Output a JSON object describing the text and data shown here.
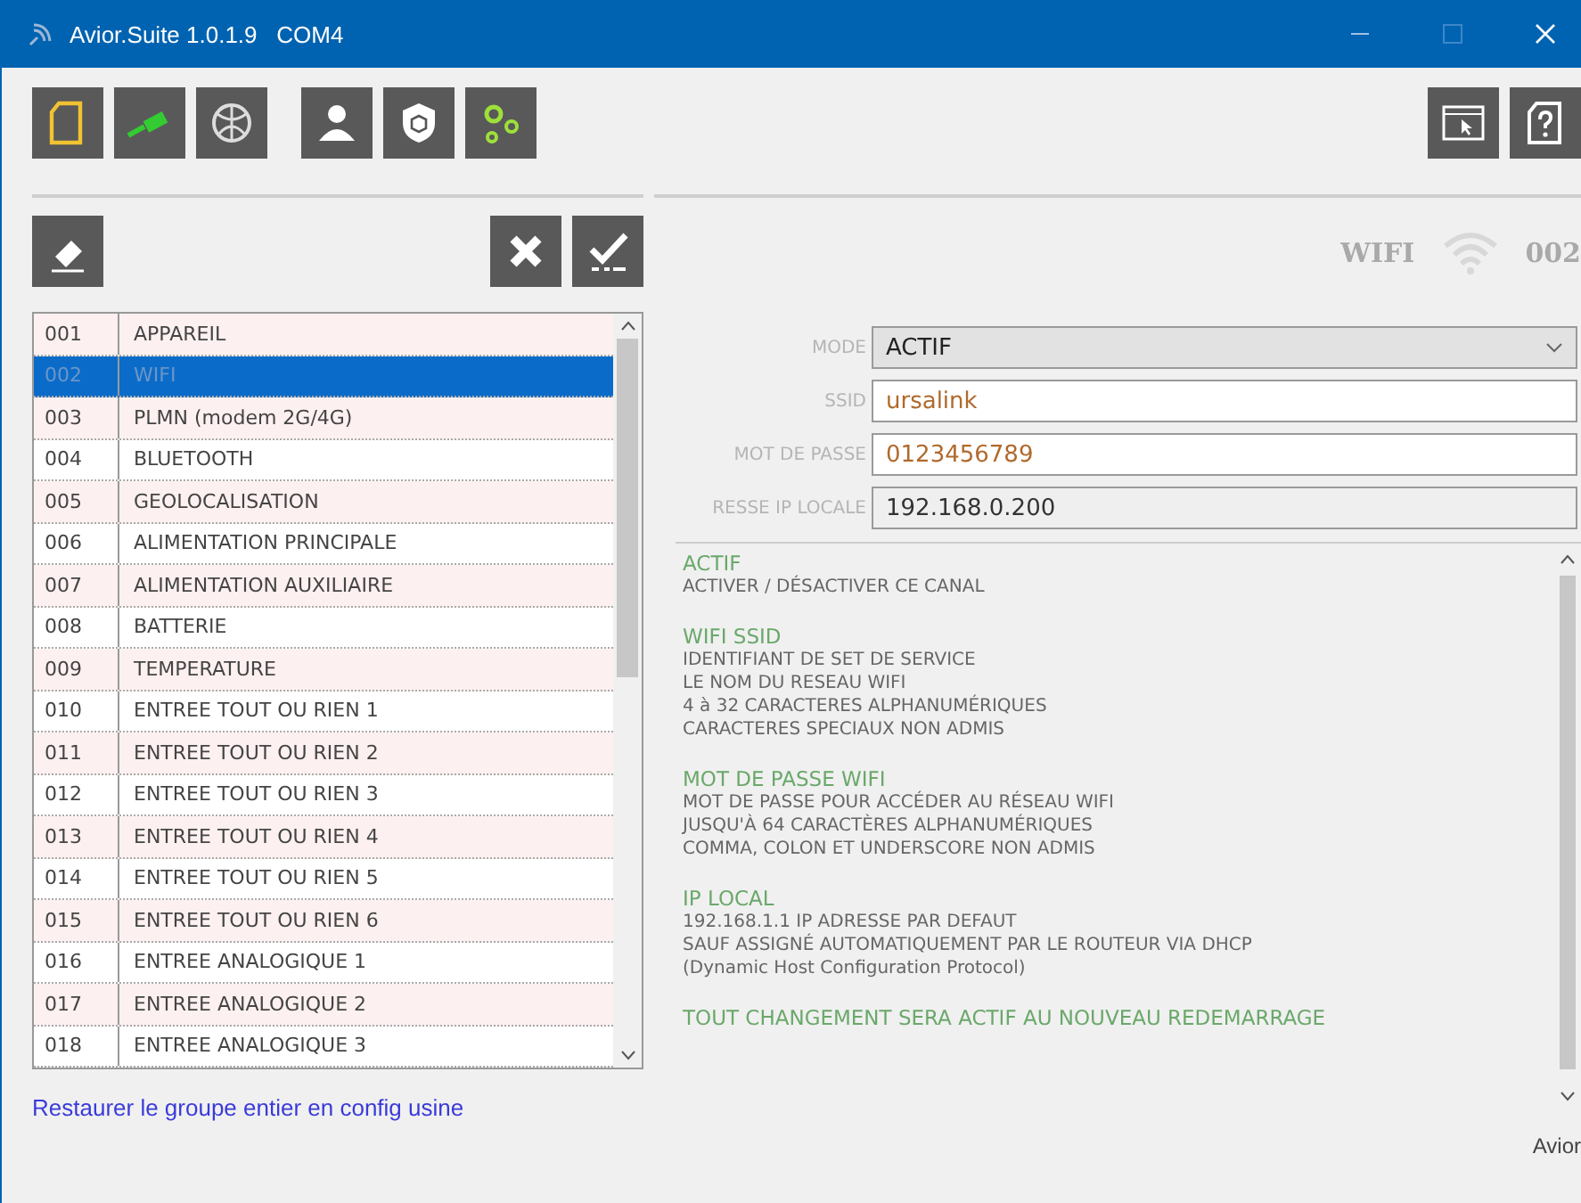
{
  "window": {
    "title": "Avior.Suite 1.0.1.9   COM4"
  },
  "toolbar": [
    {
      "kind": "file"
    },
    {
      "kind": "cable"
    },
    {
      "kind": "globe"
    },
    {
      "kind": "user"
    },
    {
      "kind": "shield"
    },
    {
      "kind": "gears"
    }
  ],
  "toolbar_right": [
    {
      "kind": "window"
    },
    {
      "kind": "help"
    }
  ],
  "actions": [
    {
      "kind": "eraser"
    },
    {
      "kind": "cancel"
    },
    {
      "kind": "confirm"
    }
  ],
  "header": {
    "name": "WIFI",
    "number": "002"
  },
  "list": [
    {
      "code": "001",
      "label": "APPAREIL",
      "selected": false
    },
    {
      "code": "002",
      "label": "WIFI",
      "selected": true
    },
    {
      "code": "003",
      "label": "PLMN (modem 2G/4G)",
      "selected": false
    },
    {
      "code": "004",
      "label": "BLUETOOTH",
      "selected": false
    },
    {
      "code": "005",
      "label": "GEOLOCALISATION",
      "selected": false
    },
    {
      "code": "006",
      "label": "ALIMENTATION PRINCIPALE",
      "selected": false
    },
    {
      "code": "007",
      "label": "ALIMENTATION AUXILIAIRE",
      "selected": false
    },
    {
      "code": "008",
      "label": "BATTERIE",
      "selected": false
    },
    {
      "code": "009",
      "label": "TEMPERATURE",
      "selected": false
    },
    {
      "code": "010",
      "label": "ENTREE TOUT OU RIEN 1",
      "selected": false
    },
    {
      "code": "011",
      "label": "ENTREE TOUT OU RIEN 2",
      "selected": false
    },
    {
      "code": "012",
      "label": "ENTREE TOUT OU RIEN 3",
      "selected": false
    },
    {
      "code": "013",
      "label": "ENTREE TOUT OU RIEN 4",
      "selected": false
    },
    {
      "code": "014",
      "label": "ENTREE TOUT OU RIEN 5",
      "selected": false
    },
    {
      "code": "015",
      "label": "ENTREE TOUT OU RIEN 6",
      "selected": false
    },
    {
      "code": "016",
      "label": "ENTREE ANALOGIQUE 1",
      "selected": false
    },
    {
      "code": "017",
      "label": "ENTREE ANALOGIQUE 2",
      "selected": false
    },
    {
      "code": "018",
      "label": "ENTREE ANALOGIQUE 3",
      "selected": false
    }
  ],
  "fields": [
    {
      "label": "MODE",
      "value": "ACTIF",
      "kind": "select"
    },
    {
      "label": "SSID",
      "value": "ursalink",
      "kind": "text"
    },
    {
      "label": "MOT DE PASSE",
      "value": "0123456789",
      "kind": "text"
    },
    {
      "label": "RESSE IP LOCALE",
      "value": "192.168.0.200",
      "kind": "readonly"
    }
  ],
  "help": [
    {
      "title": "ACTIF",
      "lines": [
        "ACTIVER / DÉSACTIVER CE CANAL"
      ]
    },
    {
      "title": "WIFI SSID",
      "lines": [
        "IDENTIFIANT DE SET DE SERVICE",
        "LE NOM DU RESEAU WIFI",
        "4 à 32 CARACTERES ALPHANUMÉRIQUES",
        "CARACTERES SPECIAUX NON ADMIS"
      ]
    },
    {
      "title": "MOT DE PASSE WIFI",
      "lines": [
        "MOT DE PASSE POUR ACCÉDER AU RÉSEAU WIFI",
        "JUSQU'À 64 CARACTÈRES ALPHANUMÉRIQUES",
        "COMMA, COLON ET UNDERSCORE NON ADMIS"
      ]
    },
    {
      "title": "IP LOCAL",
      "lines": [
        "192.168.1.1 IP ADRESSE PAR DEFAUT",
        "SAUF ASSIGNÉ AUTOMATIQUEMENT PAR LE ROUTEUR VIA DHCP",
        "(Dynamic Host Configuration Protocol)"
      ]
    }
  ],
  "help_note": "TOUT CHANGEMENT SERA ACTIF AU NOUVEAU REDEMARRAGE",
  "footer": {
    "link": "Restaurer le groupe entier en config usine",
    "brand": "Avior"
  }
}
